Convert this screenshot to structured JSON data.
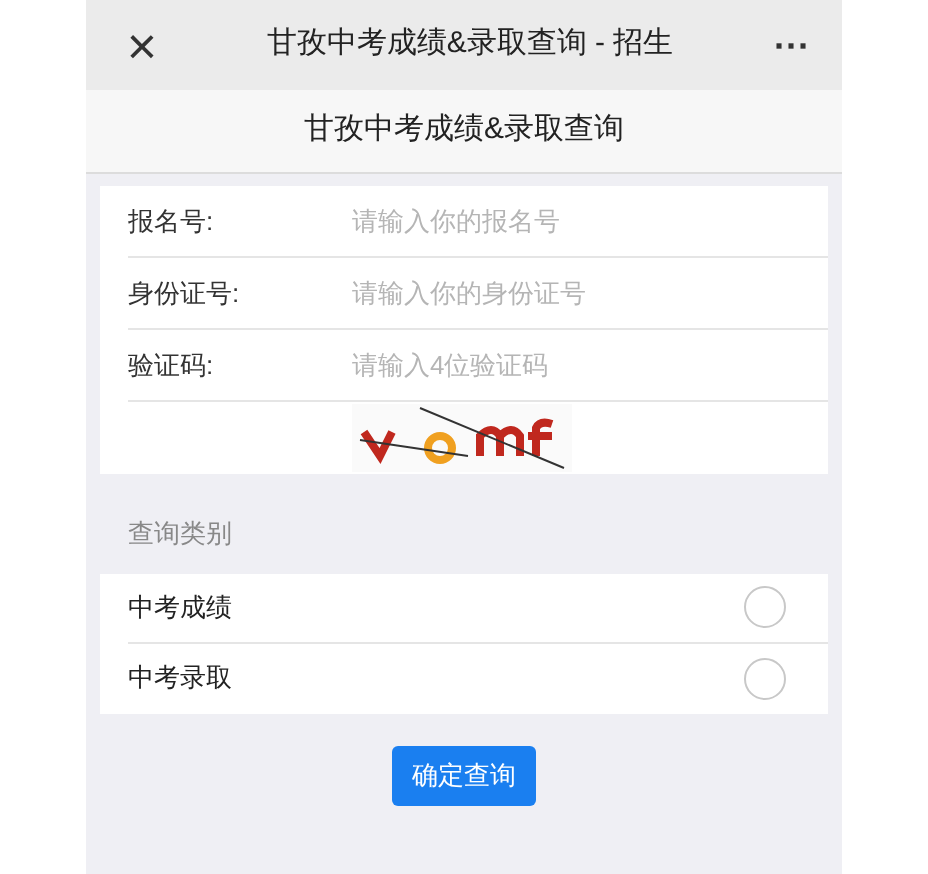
{
  "top_bar": {
    "close": "×",
    "title": "甘孜中考成绩&录取查询 - 招生",
    "more": "···"
  },
  "header": {
    "title": "甘孜中考成绩&录取查询"
  },
  "form": {
    "fields": [
      {
        "label": "报名号:",
        "placeholder": "请输入你的报名号"
      },
      {
        "label": "身份证号:",
        "placeholder": "请输入你的身份证号"
      },
      {
        "label": "验证码:",
        "placeholder": "请输入4位验证码"
      }
    ]
  },
  "category": {
    "title": "查询类别",
    "options": [
      {
        "label": "中考成绩",
        "selected": false
      },
      {
        "label": "中考录取",
        "selected": false
      }
    ]
  },
  "submit": "确定查询"
}
